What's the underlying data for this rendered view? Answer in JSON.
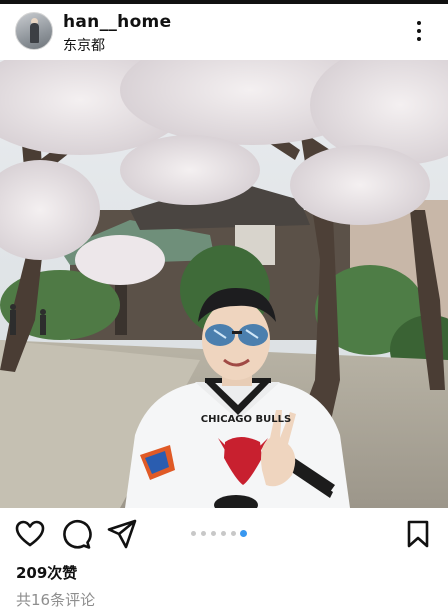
{
  "post": {
    "username": "han__home",
    "location": "东京都",
    "likes": "209次赞",
    "comments_link": "共16条评论",
    "carousel": {
      "count": 6,
      "active_index": 5
    }
  },
  "photo": {
    "jacket_text": "CHICAGO BULLS"
  },
  "colors": {
    "accent": "#3897f0",
    "dot_inactive": "#c8c8c8",
    "muted_text": "#8e8e8e"
  },
  "icons": {
    "like": "heart-outline-icon",
    "comment": "speech-bubble-icon",
    "share": "paper-plane-icon",
    "save": "bookmark-icon",
    "more": "three-dots-vertical-icon"
  }
}
